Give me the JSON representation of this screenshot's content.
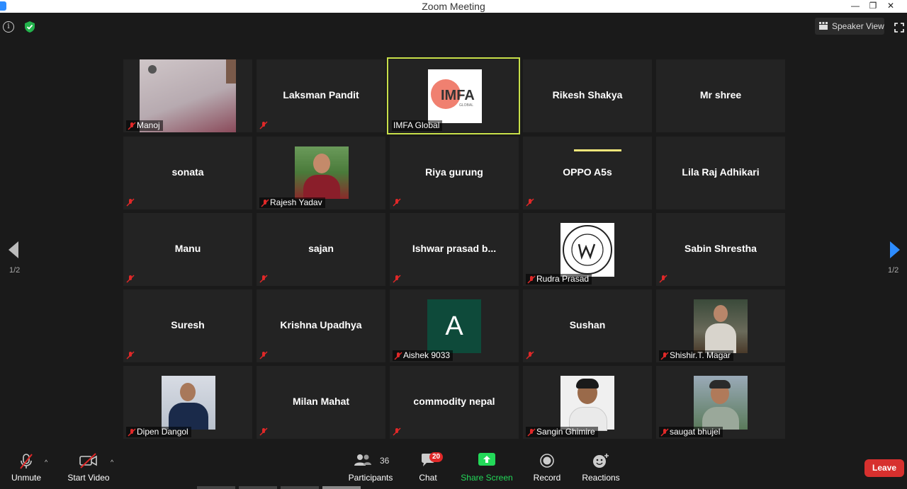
{
  "window": {
    "title": "Zoom Meeting",
    "minimize": "—",
    "restore": "❐",
    "close": "✕"
  },
  "topbar": {
    "info_glyph": "i",
    "speaker_view": "Speaker View"
  },
  "participants": [
    {
      "name": "Manoj",
      "kind": "video"
    },
    {
      "name": "Laksman Pandit",
      "kind": "name"
    },
    {
      "name": "IMFA Global",
      "kind": "logo",
      "logo_text": "IMFA",
      "logo_sub": "GLOBAL",
      "active": true
    },
    {
      "name": "Rikesh Shakya",
      "kind": "name"
    },
    {
      "name": "Mr shree",
      "kind": "name"
    },
    {
      "name": "sonata",
      "kind": "name"
    },
    {
      "name": "Rajesh Yadav",
      "kind": "photo"
    },
    {
      "name": "Riya gurung",
      "kind": "name"
    },
    {
      "name": "OPPO A5s",
      "kind": "name"
    },
    {
      "name": "Lila Raj Adhikari",
      "kind": "name"
    },
    {
      "name": "Manu",
      "kind": "name"
    },
    {
      "name": "sajan",
      "kind": "name"
    },
    {
      "name": "Ishwar  prasad  b...",
      "kind": "name"
    },
    {
      "name": "Rudra Prasad",
      "kind": "seal"
    },
    {
      "name": "Sabin Shrestha",
      "kind": "name"
    },
    {
      "name": "Suresh",
      "kind": "name"
    },
    {
      "name": "Krishna Upadhya",
      "kind": "name"
    },
    {
      "name": "Aishek 9033",
      "kind": "avatar",
      "initial": "A"
    },
    {
      "name": "Sushan",
      "kind": "name"
    },
    {
      "name": "Shishir.T. Magar",
      "kind": "photo"
    },
    {
      "name": "Dipen Dangol",
      "kind": "photo"
    },
    {
      "name": "Milan Mahat",
      "kind": "name"
    },
    {
      "name": "commodity nepal",
      "kind": "name"
    },
    {
      "name": "Sangin Ghimire",
      "kind": "photo"
    },
    {
      "name": "saugat bhujel",
      "kind": "photo"
    }
  ],
  "pagination": {
    "prev_label": "1/2",
    "next_label": "1/2"
  },
  "toolbar": {
    "unmute": "Unmute",
    "start_video": "Start Video",
    "participants": "Participants",
    "participants_count": "36",
    "chat": "Chat",
    "chat_badge": "20",
    "share_screen": "Share Screen",
    "record": "Record",
    "reactions": "Reactions",
    "leave": "Leave"
  },
  "colors": {
    "active_border": "#c8e04a",
    "share_green": "#23d959",
    "leave_red": "#d7302e",
    "avatar_bg": "#0e4a3a",
    "mute_red": "#e02828"
  }
}
